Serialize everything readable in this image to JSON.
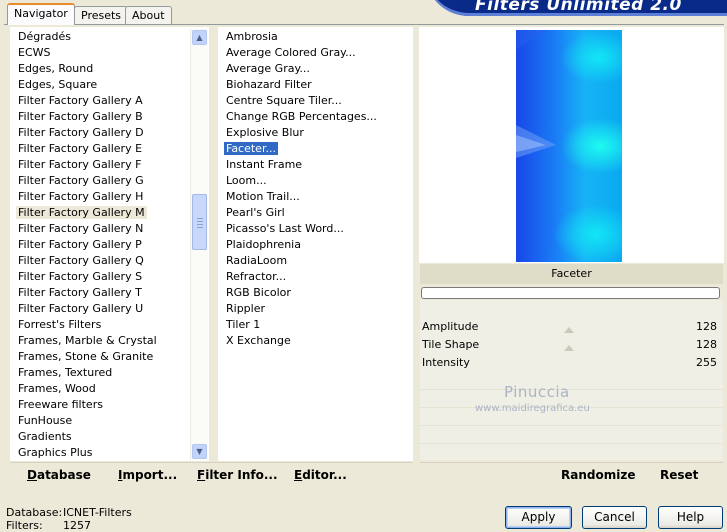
{
  "banner": {
    "title": "Filters Unlimited 2.0"
  },
  "tabs": [
    {
      "label": "Navigator",
      "active": true
    },
    {
      "label": "Presets",
      "active": false
    },
    {
      "label": "About",
      "active": false
    }
  ],
  "categories": {
    "items": [
      "Dégradés",
      "ECWS",
      "Edges, Round",
      "Edges, Square",
      "Filter Factory Gallery A",
      "Filter Factory Gallery B",
      "Filter Factory Gallery D",
      "Filter Factory Gallery E",
      "Filter Factory Gallery F",
      "Filter Factory Gallery G",
      "Filter Factory Gallery H",
      "Filter Factory Gallery M",
      "Filter Factory Gallery N",
      "Filter Factory Gallery P",
      "Filter Factory Gallery Q",
      "Filter Factory Gallery S",
      "Filter Factory Gallery T",
      "Filter Factory Gallery U",
      "Forrest's Filters",
      "Frames, Marble & Crystal",
      "Frames, Stone & Granite",
      "Frames, Textured",
      "Frames, Wood",
      "Freeware filters",
      "FunHouse",
      "Gradients",
      "Graphics Plus"
    ],
    "selected": "Filter Factory Gallery M"
  },
  "filters": {
    "items": [
      "Ambrosia",
      "Average Colored Gray...",
      "Average Gray...",
      "Biohazard Filter",
      "Centre Square Tiler...",
      "Change RGB Percentages...",
      "Explosive Blur",
      "Faceter...",
      "Instant Frame",
      "Loom...",
      "Motion Trail...",
      "Pearl's Girl",
      "Picasso's Last Word...",
      "Plaidophrenia",
      "RadiaLoom",
      "Refractor...",
      "RGB Bicolor",
      "Rippler",
      "Tiler 1",
      "X Exchange"
    ],
    "selected": "Faceter..."
  },
  "left_buttons": [
    {
      "label": "Database",
      "mnemonic": "D",
      "rest": "atabase"
    },
    {
      "label": "Import...",
      "mnemonic": "I",
      "rest": "mport..."
    },
    {
      "label": "Filter Info...",
      "mnemonic": "F",
      "rest": "ilter Info..."
    },
    {
      "label": "Editor...",
      "mnemonic": "E",
      "rest": "ditor..."
    }
  ],
  "preview": {
    "filter_name": "Faceter"
  },
  "params": [
    {
      "label": "Amplitude",
      "value": "128"
    },
    {
      "label": "Tile Shape",
      "value": "128"
    },
    {
      "label": "Intensity",
      "value": "255"
    }
  ],
  "right_buttons": {
    "randomize": "Randomize",
    "reset": "Reset"
  },
  "watermark": {
    "line1": "Pinuccia",
    "line2": "www.maidiregrafica.eu"
  },
  "footer": {
    "database_label": "Database:",
    "database_value": "ICNET-Filters",
    "filters_label": "Filters:",
    "filters_value": "1257",
    "apply": "Apply",
    "cancel": "Cancel",
    "help": "Help"
  },
  "colors": {
    "selection": "#316ac5",
    "banner": "#0a2a8a",
    "window": "#ece9d8"
  }
}
